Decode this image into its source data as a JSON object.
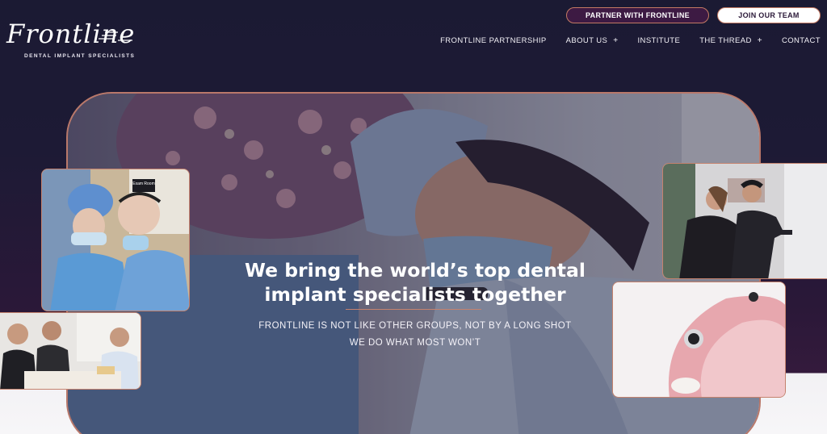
{
  "brand": {
    "logo_script": "Frontline",
    "logo_sub": "DENTAL IMPLANT SPECIALISTS"
  },
  "header": {
    "partner_button": "PARTNER WITH FRONTLINE",
    "join_button": "JOIN OUR TEAM",
    "nav": [
      {
        "label": "FRONTLINE PARTNERSHIP",
        "has_submenu": false
      },
      {
        "label": "ABOUT US",
        "has_submenu": true
      },
      {
        "label": "INSTITUTE",
        "has_submenu": false
      },
      {
        "label": "THE THREAD",
        "has_submenu": true
      },
      {
        "label": "CONTACT",
        "has_submenu": false
      }
    ],
    "plus_symbol": "+"
  },
  "hero": {
    "headline_line1": "We bring the world’s top dental",
    "headline_line2": "implant specialists together",
    "subline1": "FRONTLINE IS NOT LIKE OTHER GROUPS, NOT BY A LONG SHOT",
    "subline2": "WE DO WHAT MOST WON’T"
  },
  "photos": {
    "left_sign": "Exam Room"
  },
  "colors": {
    "background": "#1b1a33",
    "accent_border": "#c4826e",
    "partner_button_bg": "#3d1a43"
  }
}
